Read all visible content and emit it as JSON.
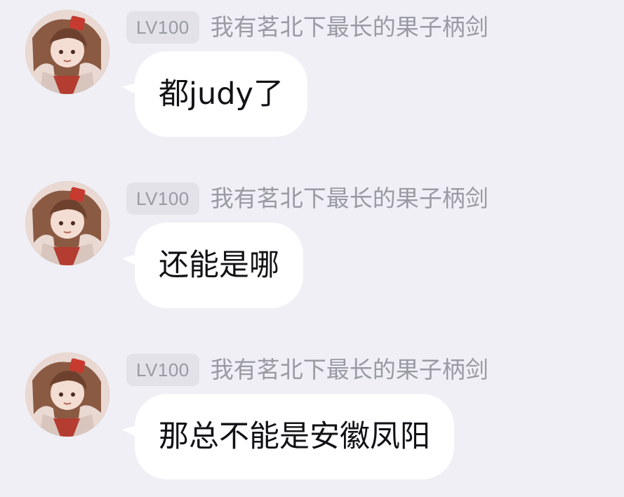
{
  "messages": [
    {
      "level": "LV100",
      "sender": "我有茗北下最长的果子柄剑",
      "text": "都judy了"
    },
    {
      "level": "LV100",
      "sender": "我有茗北下最长的果子柄剑",
      "text": "还能是哪"
    },
    {
      "level": "LV100",
      "sender": "我有茗北下最长的果子柄剑",
      "text": "那总不能是安徽凤阳"
    }
  ]
}
